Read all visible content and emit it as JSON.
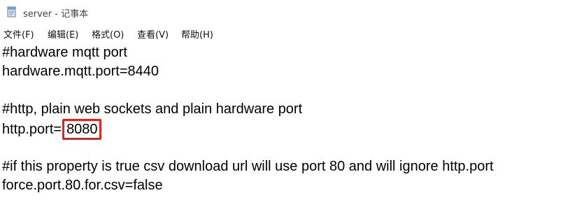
{
  "window": {
    "title": "server - 记事本",
    "icon": "notepad-icon"
  },
  "menu": [
    {
      "label": "文件(F)"
    },
    {
      "label": "编辑(E)"
    },
    {
      "label": "格式(O)"
    },
    {
      "label": "查看(V)"
    },
    {
      "label": "帮助(H)"
    }
  ],
  "editor": {
    "line1": "#hardware mqtt port",
    "line2": "hardware.mqtt.port=8440",
    "line4": "#http, plain web sockets and plain hardware port",
    "line5_key": "http.port=",
    "line5_value": "8080",
    "line7": "#if this property is true csv download url will use port 80 and will ignore http.port",
    "line8": "force.port.80.for.csv=false"
  },
  "colors": {
    "highlight_box": "#e2231a",
    "text": "#000000"
  }
}
